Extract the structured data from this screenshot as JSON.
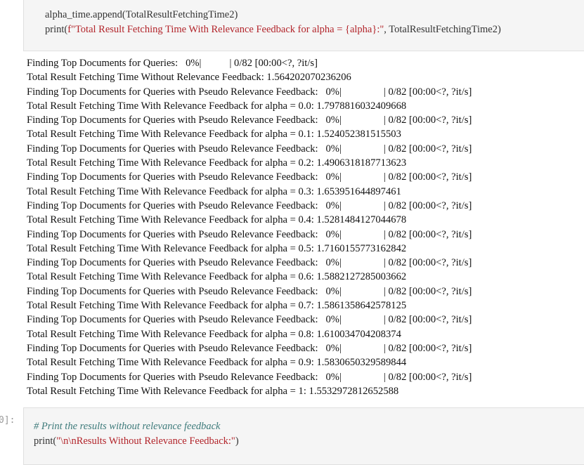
{
  "top_cell": {
    "line1": "alpha_time.append(TotalResultFetchingTime2)",
    "line2_prefix": "print(",
    "line2_string": "f\"Total Result Fetching Time With Relevance Feedback for alpha = {alpha}:\"",
    "line2_suffix": ", TotalResultFetchingTime2)"
  },
  "output": {
    "lines": [
      {
        "text": "Finding Top Documents for Queries:   0%|",
        "progress": "| 0/82 [00:00<?, ?it/s]",
        "kind": "progress1"
      },
      {
        "text": "Total Result Fetching Time Without Relevance Feedback: 1.564202070236206"
      },
      {
        "text": "Finding Top Documents for Queries with Pseudo Relevance Feedback:   0%|",
        "progress": "| 0/82 [00:00<?, ?it/s]",
        "kind": "progress2"
      },
      {
        "text": "Total Result Fetching Time With Relevance Feedback for alpha = 0.0: 1.7978816032409668"
      },
      {
        "text": "Finding Top Documents for Queries with Pseudo Relevance Feedback:   0%|",
        "progress": "| 0/82 [00:00<?, ?it/s]",
        "kind": "progress2"
      },
      {
        "text": "Total Result Fetching Time With Relevance Feedback for alpha = 0.1: 1.524052381515503"
      },
      {
        "text": "Finding Top Documents for Queries with Pseudo Relevance Feedback:   0%|",
        "progress": "| 0/82 [00:00<?, ?it/s]",
        "kind": "progress2"
      },
      {
        "text": "Total Result Fetching Time With Relevance Feedback for alpha = 0.2: 1.4906318187713623"
      },
      {
        "text": "Finding Top Documents for Queries with Pseudo Relevance Feedback:   0%|",
        "progress": "| 0/82 [00:00<?, ?it/s]",
        "kind": "progress2"
      },
      {
        "text": "Total Result Fetching Time With Relevance Feedback for alpha = 0.3: 1.653951644897461"
      },
      {
        "text": "Finding Top Documents for Queries with Pseudo Relevance Feedback:   0%|",
        "progress": "| 0/82 [00:00<?, ?it/s]",
        "kind": "progress2"
      },
      {
        "text": "Total Result Fetching Time With Relevance Feedback for alpha = 0.4: 1.5281484127044678"
      },
      {
        "text": "Finding Top Documents for Queries with Pseudo Relevance Feedback:   0%|",
        "progress": "| 0/82 [00:00<?, ?it/s]",
        "kind": "progress2"
      },
      {
        "text": "Total Result Fetching Time With Relevance Feedback for alpha = 0.5: 1.7160155773162842"
      },
      {
        "text": "Finding Top Documents for Queries with Pseudo Relevance Feedback:   0%|",
        "progress": "| 0/82 [00:00<?, ?it/s]",
        "kind": "progress2"
      },
      {
        "text": "Total Result Fetching Time With Relevance Feedback for alpha = 0.6: 1.5882127285003662"
      },
      {
        "text": "Finding Top Documents for Queries with Pseudo Relevance Feedback:   0%|",
        "progress": "| 0/82 [00:00<?, ?it/s]",
        "kind": "progress2"
      },
      {
        "text": "Total Result Fetching Time With Relevance Feedback for alpha = 0.7: 1.5861358642578125"
      },
      {
        "text": "Finding Top Documents for Queries with Pseudo Relevance Feedback:   0%|",
        "progress": "| 0/82 [00:00<?, ?it/s]",
        "kind": "progress2"
      },
      {
        "text": "Total Result Fetching Time With Relevance Feedback for alpha = 0.8: 1.610034704208374"
      },
      {
        "text": "Finding Top Documents for Queries with Pseudo Relevance Feedback:   0%|",
        "progress": "| 0/82 [00:00<?, ?it/s]",
        "kind": "progress2"
      },
      {
        "text": "Total Result Fetching Time With Relevance Feedback for alpha = 0.9: 1.5830650329589844"
      },
      {
        "text": "Finding Top Documents for Queries with Pseudo Relevance Feedback:   0%|",
        "progress": "| 0/82 [00:00<?, ?it/s]",
        "kind": "progress2"
      },
      {
        "text": "Total Result Fetching Time With Relevance Feedback for alpha = 1: 1.5532972812652588"
      }
    ]
  },
  "bottom_cell": {
    "prompt": "0]:",
    "comment": "# Print the results without relevance feedback",
    "line2_prefix": "print(",
    "line2_string": "\"\\n\\nResults Without Relevance Feedback:\"",
    "line2_suffix": ")"
  }
}
